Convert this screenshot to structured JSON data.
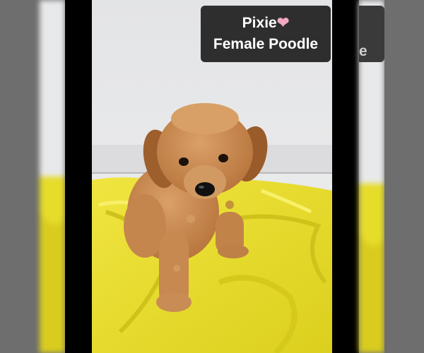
{
  "caption": {
    "name_line": "Pixie",
    "heart_icon": "pink-heart-icon",
    "heart_glyph": "❤",
    "heart_color": "#f2a7c3",
    "breed_line": "Female Poodle",
    "echo_fragment": "e"
  },
  "colors": {
    "frame_bars": "#000000",
    "side_background": "#6e6e6e",
    "caption_box": "#2e2e2e",
    "blanket": "#ece12a",
    "puppy_coat": "#c98a4f",
    "wall": "#e9eaec"
  }
}
